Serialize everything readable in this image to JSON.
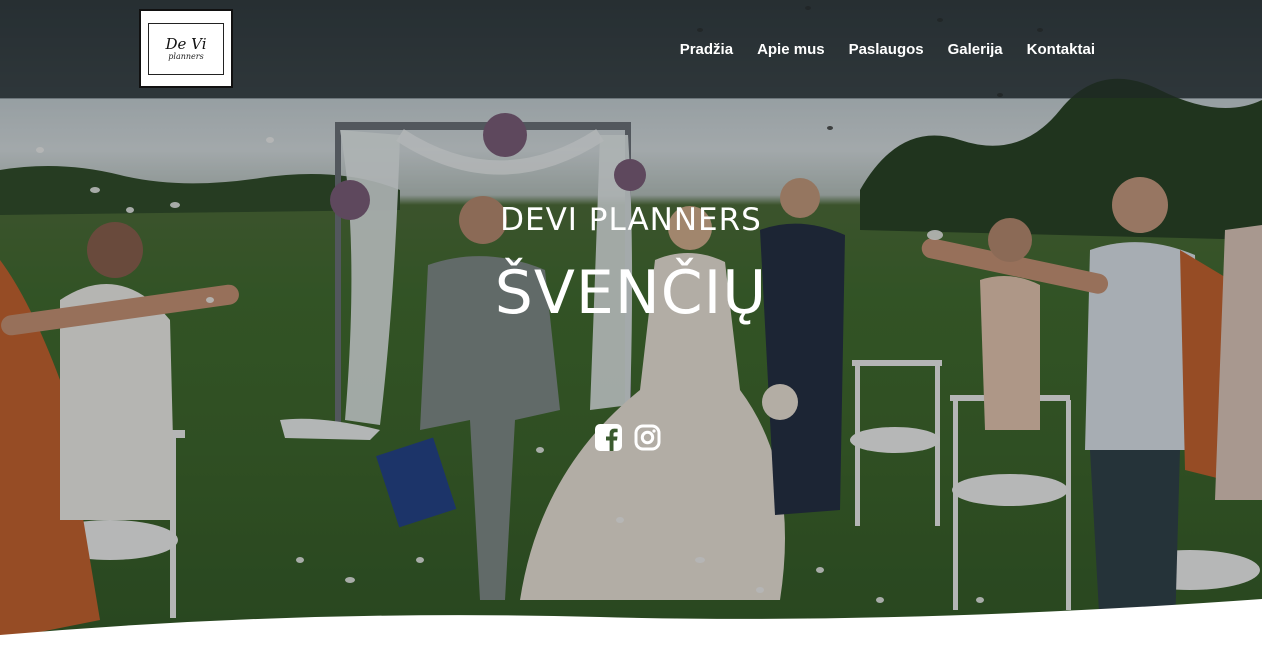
{
  "brand": {
    "logo_main": "De Vi",
    "logo_sub": "planners"
  },
  "nav": {
    "items": [
      {
        "label": "Pradžia"
      },
      {
        "label": "Apie mus"
      },
      {
        "label": "Paslaugos"
      },
      {
        "label": "Galerija"
      },
      {
        "label": "Kontaktai"
      }
    ]
  },
  "hero": {
    "subtitle": "DEVI PLANNERS",
    "title": "ŠVENČIŲ"
  },
  "social": {
    "icons": [
      "facebook-icon",
      "instagram-icon"
    ]
  },
  "colors": {
    "text": "#ffffff",
    "header_overlay": "rgba(30,36,38,0.55)",
    "grass": "#3d6a2a"
  }
}
